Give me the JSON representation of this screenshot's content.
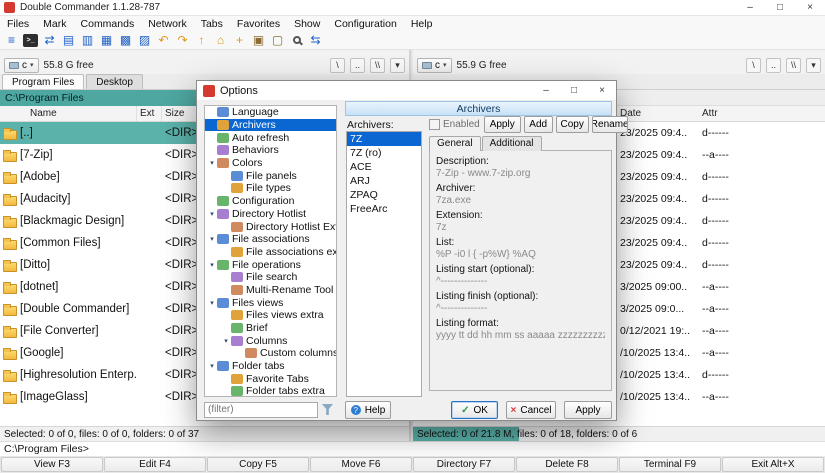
{
  "colors": {
    "accent_teal": "#4FA7A1",
    "selection_teal": "#5BB2AB",
    "selection_blue": "#0A66D0",
    "dialog_header_blue": "#C7E0F6",
    "folder_yellow": "#F2B93E"
  },
  "icons": {
    "minimize": "–",
    "maximize": "□",
    "close": "×",
    "dropdown": "▾",
    "tree_expander": "▾"
  },
  "window": {
    "title": "Double Commander 1.1.28-787"
  },
  "menubar": [
    "Files",
    "Mark",
    "Commands",
    "Network",
    "Tabs",
    "Favorites",
    "Show",
    "Configuration",
    "Help"
  ],
  "toolbar": [
    {
      "name": "menu-icon",
      "glyph": "≡"
    },
    {
      "name": "terminal-icon",
      "glyph": ">_"
    },
    {
      "name": "swap-panels-icon",
      "glyph": "⇄"
    },
    {
      "name": "brief-view-icon",
      "glyph": "▤"
    },
    {
      "name": "full-view-icon",
      "glyph": "▥"
    },
    {
      "name": "columns-view-icon",
      "glyph": "▦"
    },
    {
      "name": "thumbnails-view-icon",
      "glyph": "▩"
    },
    {
      "name": "flat-view-icon",
      "glyph": "▨"
    },
    {
      "name": "back-icon",
      "glyph": "↶"
    },
    {
      "name": "forward-icon",
      "glyph": "↷"
    },
    {
      "name": "parent-dir-icon",
      "glyph": "↑"
    },
    {
      "name": "root-dir-icon",
      "glyph": "⌂"
    },
    {
      "name": "new-folder-icon",
      "glyph": "+"
    },
    {
      "name": "pack-icon",
      "glyph": "▣"
    },
    {
      "name": "unpack-icon",
      "glyph": "▢"
    },
    {
      "name": "search-icon",
      "glyph": ""
    },
    {
      "name": "sync-dirs-icon",
      "glyph": "⇆"
    }
  ],
  "left_panel": {
    "drive": "c",
    "free_space": "55.8 G free",
    "nav": [
      "\\",
      "..",
      "\\\\"
    ],
    "tabs": [
      "Program Files",
      "Desktop"
    ],
    "path": "C:\\Program Files",
    "columns": [
      "Name",
      "Ext",
      "Size"
    ],
    "rows": [
      {
        "name": "[..]",
        "size": "<DIR>"
      },
      {
        "name": "[7-Zip]",
        "size": "<DIR>"
      },
      {
        "name": "[Adobe]",
        "size": "<DIR>"
      },
      {
        "name": "[Audacity]",
        "size": "<DIR>"
      },
      {
        "name": "[Blackmagic Design]",
        "size": "<DIR>"
      },
      {
        "name": "[Common Files]",
        "size": "<DIR>"
      },
      {
        "name": "[Ditto]",
        "size": "<DIR>"
      },
      {
        "name": "[dotnet]",
        "size": "<DIR>"
      },
      {
        "name": "[Double Commander]",
        "size": "<DIR>"
      },
      {
        "name": "[File Converter]",
        "size": "<DIR>"
      },
      {
        "name": "[Google]",
        "size": "<DIR>"
      },
      {
        "name": "[Highresolution Enterp..]",
        "size": "<DIR>"
      },
      {
        "name": "[ImageGlass]",
        "size": "<DIR>"
      }
    ],
    "status": "Selected: 0 of 0, files: 0 of 0, folders: 0 of 37"
  },
  "right_panel": {
    "drive": "c",
    "free_space": "55.9 G free",
    "nav": [
      "\\",
      "..",
      "\\\\"
    ],
    "columns": [
      "Date",
      "Attr"
    ],
    "rows": [
      {
        "date": "23/2025 09:4..",
        "attr": "d------"
      },
      {
        "date": "23/2025 09:4..",
        "attr": "--a----"
      },
      {
        "date": "23/2025 09:4..",
        "attr": "d------"
      },
      {
        "date": "23/2025 09:4..",
        "attr": "d------"
      },
      {
        "date": "23/2025 09:4..",
        "attr": "d------"
      },
      {
        "date": "23/2025 09:4..",
        "attr": "d------"
      },
      {
        "date": "23/2025 09:4..",
        "attr": "d------"
      },
      {
        "date": "3/2025 09:00..",
        "attr": "--a----"
      },
      {
        "date": "3/2025 09:0...",
        "attr": "--a----"
      },
      {
        "date": "0/12/2021 19:..",
        "attr": "--a----"
      },
      {
        "date": "/10/2025 13:4..",
        "attr": "--a----"
      },
      {
        "date": "/10/2025 13:4..",
        "attr": "d------"
      },
      {
        "date": "/10/2025 13:4..",
        "attr": "--a----"
      }
    ],
    "status": "Selected: 0 of 21.8 M, files: 0 of 18, folders: 0 of 6"
  },
  "command_line": {
    "prompt": "C:\\Program Files>"
  },
  "function_keys": [
    "View F3",
    "Edit F4",
    "Copy F5",
    "Move F6",
    "Directory F7",
    "Delete F8",
    "Terminal F9",
    "Exit Alt+X"
  ],
  "dialog": {
    "title": "Options",
    "filter_placeholder": "(filter)",
    "tree": [
      {
        "label": "Language",
        "level": 0
      },
      {
        "label": "Archivers",
        "level": 0,
        "selected": true
      },
      {
        "label": "Auto refresh",
        "level": 0
      },
      {
        "label": "Behaviors",
        "level": 0
      },
      {
        "label": "Colors",
        "level": 0,
        "expanded": true
      },
      {
        "label": "File panels",
        "level": 1
      },
      {
        "label": "File types",
        "level": 1
      },
      {
        "label": "Configuration",
        "level": 0
      },
      {
        "label": "Directory Hotlist",
        "level": 0,
        "expanded": true
      },
      {
        "label": "Directory Hotlist Extra",
        "level": 1
      },
      {
        "label": "File associations",
        "level": 0,
        "expanded": true
      },
      {
        "label": "File associations extra",
        "level": 1
      },
      {
        "label": "File operations",
        "level": 0,
        "expanded": true
      },
      {
        "label": "File search",
        "level": 1
      },
      {
        "label": "Multi-Rename Tool",
        "level": 1
      },
      {
        "label": "Files views",
        "level": 0,
        "expanded": true
      },
      {
        "label": "Files views extra",
        "level": 1
      },
      {
        "label": "Brief",
        "level": 1
      },
      {
        "label": "Columns",
        "level": 1,
        "expanded": true
      },
      {
        "label": "Custom columns",
        "level": 2
      },
      {
        "label": "Folder tabs",
        "level": 0,
        "expanded": true
      },
      {
        "label": "Favorite Tabs",
        "level": 1
      },
      {
        "label": "Folder tabs extra",
        "level": 1
      }
    ],
    "page": {
      "header": "Archivers",
      "list_label": "Archivers:",
      "archivers": [
        "7Z",
        "7Z (ro)",
        "ACE",
        "ARJ",
        "ZPAQ",
        "FreeArc"
      ],
      "enabled_label": "Enabled",
      "action_buttons": [
        "Apply",
        "Add",
        "Copy",
        "Rename"
      ],
      "tabs": [
        "General",
        "Additional"
      ],
      "fields": [
        {
          "label": "Description:",
          "value": "7-Zip - www.7-zip.org"
        },
        {
          "label": "Archiver:",
          "value": "7za.exe"
        },
        {
          "label": "Extension:",
          "value": "7z"
        },
        {
          "label": "List:",
          "value": "%P -i0 l { -p%W} %AQ"
        },
        {
          "label": "Listing start (optional):",
          "value": "^--------------"
        },
        {
          "label": "Listing finish (optional):",
          "value": "^--------------"
        },
        {
          "label": "Listing format:",
          "value": "yyyy tt dd hh mm ss aaaaa zzzzzzzzzzzz ppppppp"
        }
      ]
    },
    "footer": {
      "help": {
        "label": "Help",
        "glyph": "?"
      },
      "ok": {
        "label": "OK",
        "glyph": "✓"
      },
      "cancel": {
        "label": "Cancel",
        "glyph": "×"
      },
      "apply": {
        "label": "Apply"
      }
    }
  }
}
